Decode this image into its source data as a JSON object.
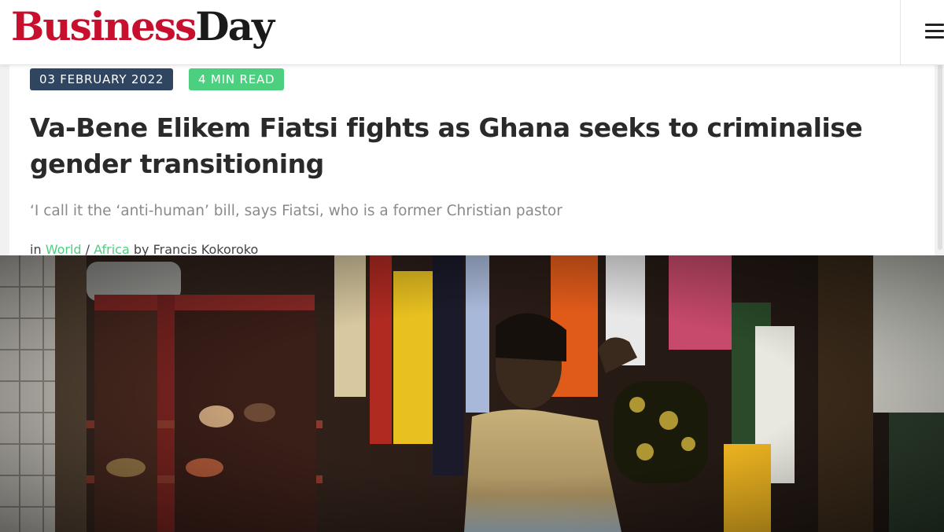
{
  "header": {
    "logo_part1": "Business",
    "logo_part2": "Day",
    "menu_icon": "hamburger-menu-icon"
  },
  "article": {
    "date": "03 FEBRUARY 2022",
    "read_time": "4 MIN READ",
    "headline": "Va-Bene Elikem Fiatsi fights as Ghana seeks to criminalise gender transitioning",
    "subheadline": "‘I call it the ‘anti-human’ bill, says Fiatsi, who is a former Christian pastor",
    "byline": {
      "prefix": "in",
      "category1": "World",
      "separator": "/",
      "category2": "Africa",
      "by_word": "by",
      "author": "Francis Kokoroko"
    }
  },
  "colors": {
    "brand_red": "#c8102e",
    "date_badge": "#2f4560",
    "accent_green": "#4cd080",
    "headline": "#2a2a2a",
    "subheadline": "#8a8a8a"
  }
}
